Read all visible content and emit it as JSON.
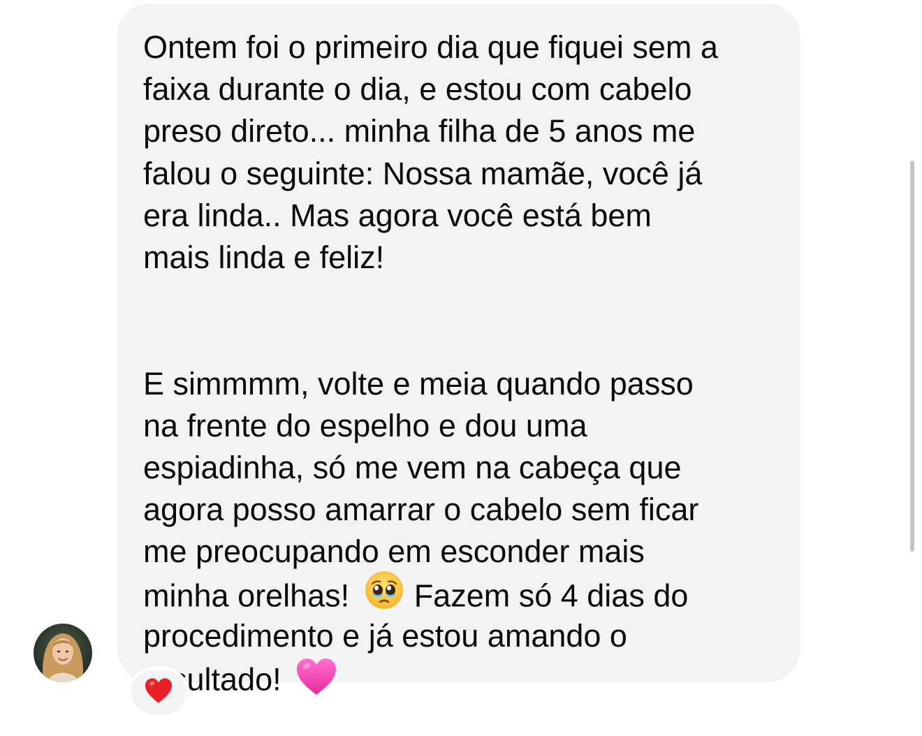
{
  "message": {
    "paragraph1": [
      "Ontem foi o primeiro dia que fiquei sem a",
      "faixa durante o dia, e estou com cabelo",
      "preso direto... minha filha de 5 anos me",
      "falou o seguinte: Nossa mamãe, você já",
      "era linda.. Mas agora você está bem",
      "mais linda e feliz!"
    ],
    "paragraph2": [
      "E simmmm, volte e meia quando passo",
      "na frente do espelho e dou uma",
      "espiadinha, só me vem na cabeça que",
      "agora posso amarrar o cabelo sem ficar",
      "me preocupando em esconder mais"
    ],
    "line_with_emoji_before": "minha orelhas!",
    "line_with_emoji_after": "Fazem só 4 dias do",
    "line_procedimento": "procedimento e já estou amando o",
    "line_final": "resultado!",
    "emoji_pleading": "pleading-face-emoji",
    "emoji_heart": "pink-heart-emoji"
  },
  "reaction": {
    "emoji": "red-heart-icon",
    "color": "#e8202a"
  },
  "colors": {
    "bubble": "#f2f3f5",
    "text": "#0a0a0a",
    "pink_heart": "#f23fb4",
    "scrollbar": "#c3c5c9"
  }
}
